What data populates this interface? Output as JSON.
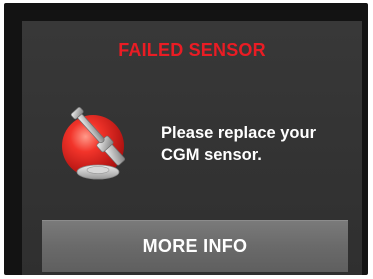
{
  "alert": {
    "title": "FAILED SENSOR",
    "message_line1": "Please replace your",
    "message_line2": "CGM sensor.",
    "icon": "sensor-applicator-icon",
    "title_color": "#ea1c24"
  },
  "actions": {
    "more_info_label": "MORE INFO"
  }
}
